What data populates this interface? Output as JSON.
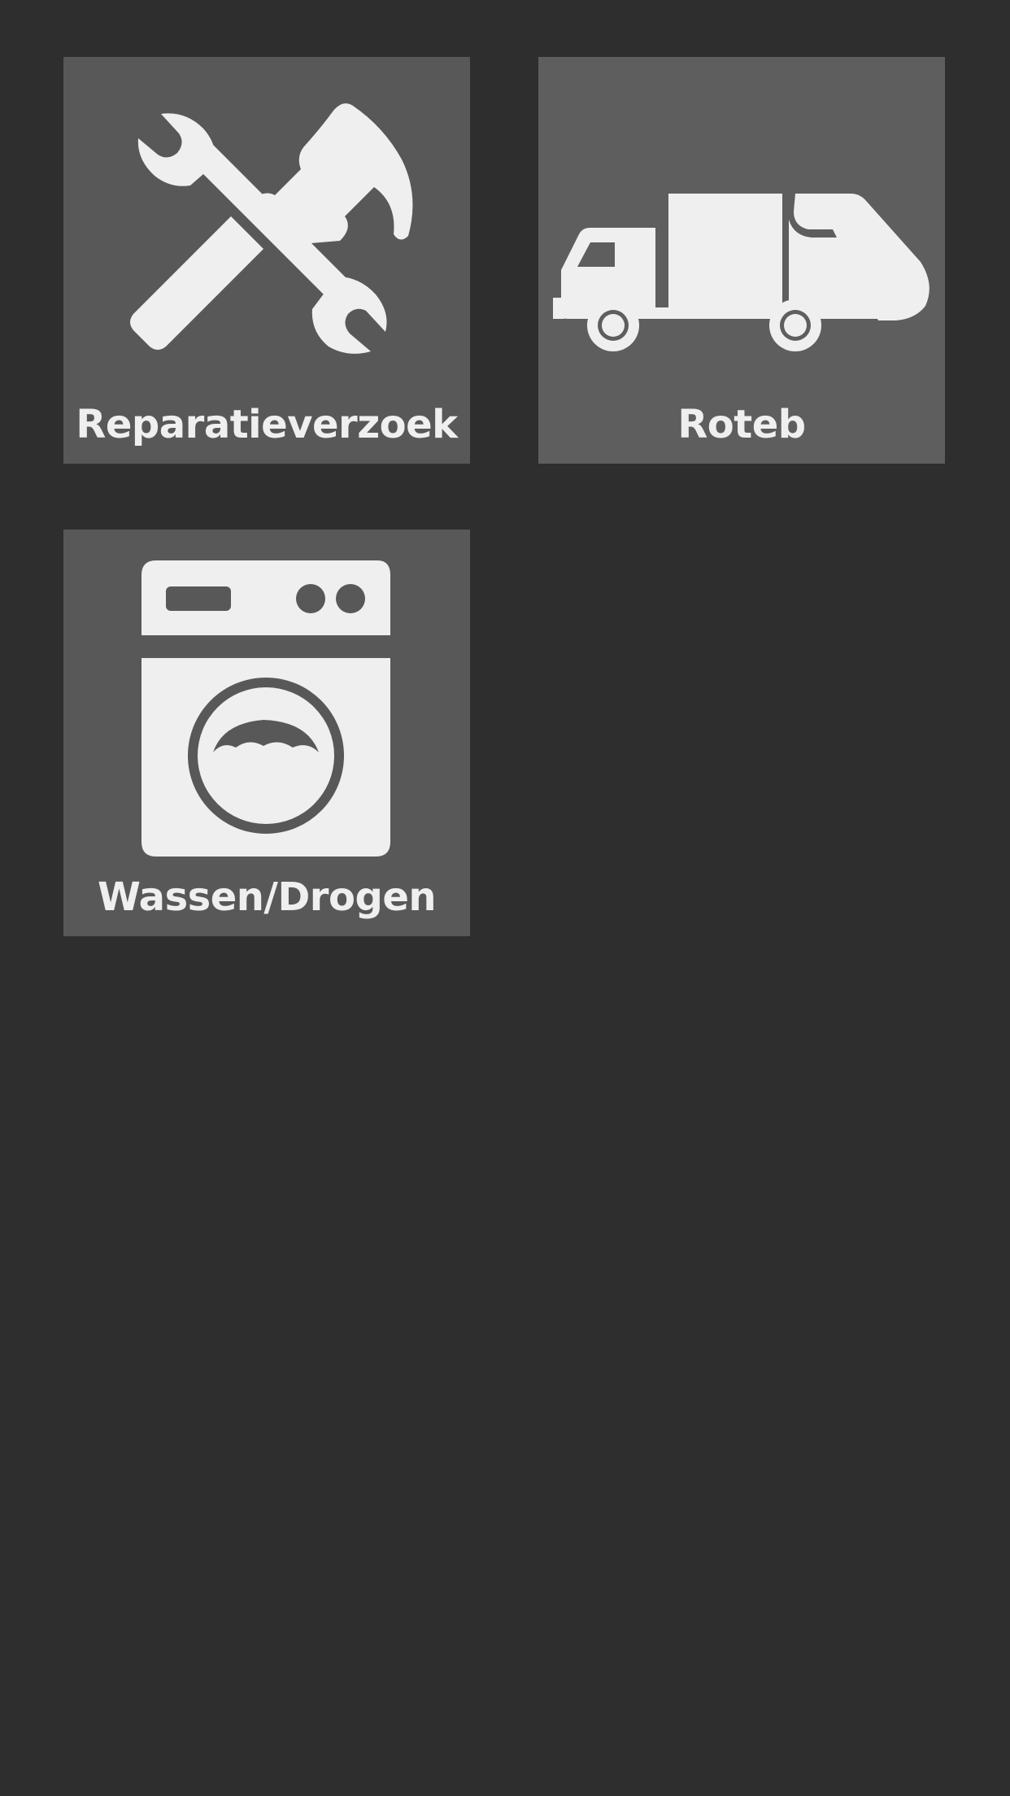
{
  "tiles": [
    {
      "label": "Reparatieverzoek",
      "icon": "tools-icon"
    },
    {
      "label": "Roteb",
      "icon": "garbage-truck-icon"
    },
    {
      "label": "Wassen/Drogen",
      "icon": "washing-machine-icon"
    }
  ],
  "colors": {
    "background": "#2e2e2e",
    "tile": "#585858",
    "icon": "#efefef",
    "label": "#efefef"
  }
}
